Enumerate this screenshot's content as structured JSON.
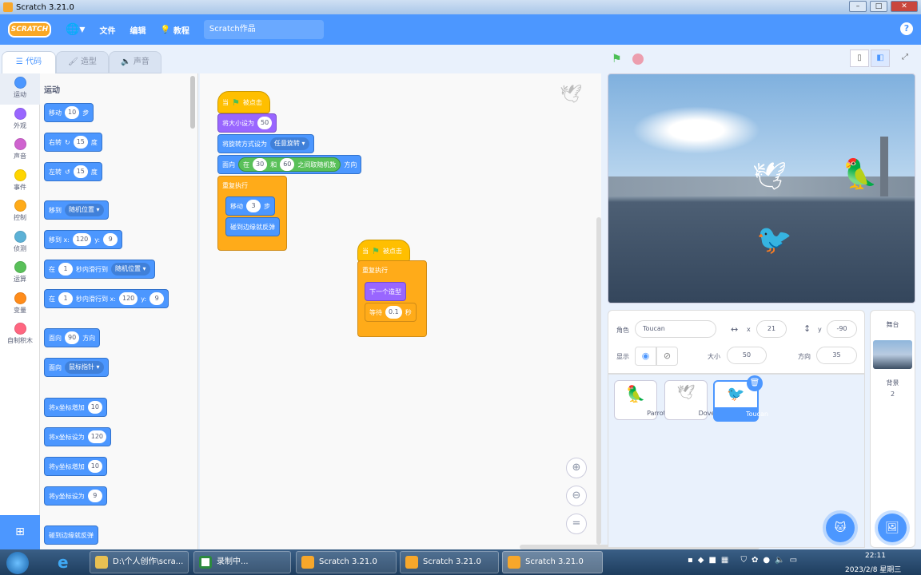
{
  "window": {
    "title": "Scratch 3.21.0"
  },
  "menu": {
    "logo": "SCRATCH",
    "file": "文件",
    "edit": "编辑",
    "tutorials": "教程",
    "project_title": "Scratch作品",
    "help": "?"
  },
  "tabs": [
    {
      "label": "代码"
    },
    {
      "label": "造型"
    },
    {
      "label": "声音"
    }
  ],
  "categories": [
    {
      "label": "运动",
      "color": "#4c97ff"
    },
    {
      "label": "外观",
      "color": "#9966ff"
    },
    {
      "label": "声音",
      "color": "#cf63cf"
    },
    {
      "label": "事件",
      "color": "#ffd500"
    },
    {
      "label": "控制",
      "color": "#ffab19"
    },
    {
      "label": "侦测",
      "color": "#5cb1d6"
    },
    {
      "label": "运算",
      "color": "#59c059"
    },
    {
      "label": "变量",
      "color": "#ff8c1a"
    },
    {
      "label": "自制积木",
      "color": "#ff6680"
    }
  ],
  "palette": {
    "heading": "运动",
    "move": {
      "a": "移动",
      "v": "10",
      "b": "步"
    },
    "turn_right": {
      "a": "右转",
      "v": "15",
      "b": "度"
    },
    "turn_left": {
      "a": "左转",
      "v": "15",
      "b": "度"
    },
    "goto": {
      "a": "移到",
      "dd": "随机位置"
    },
    "goto_xy": {
      "a": "移到 x:",
      "x": "120",
      "y_label": "y:",
      "y": "9"
    },
    "glide": {
      "a": "在",
      "v": "1",
      "b": "秒内滑行到",
      "dd": "随机位置"
    },
    "glide_xy": {
      "a": "在",
      "v": "1",
      "b": "秒内滑行到 x:",
      "x": "120",
      "y_label": "y:",
      "y": "9"
    },
    "point_dir": {
      "a": "面向",
      "v": "90",
      "b": "方向"
    },
    "point_towards": {
      "a": "面向",
      "dd": "鼠标指针"
    },
    "change_x": {
      "a": "将x坐标增加",
      "v": "10"
    },
    "set_x": {
      "a": "将x坐标设为",
      "v": "120"
    },
    "change_y": {
      "a": "将y坐标增加",
      "v": "10"
    },
    "set_y": {
      "a": "将y坐标设为",
      "v": "9"
    },
    "bounce": {
      "a": "碰到边缘就反弹"
    }
  },
  "script1": {
    "hat_a": "当",
    "hat_b": "被点击",
    "size_a": "将大小设为",
    "size_v": "50",
    "rot_a": "将旋转方式设为",
    "rot_dd": "任意旋转",
    "face_a": "面向",
    "rand_a": "在",
    "rand_v1": "30",
    "rand_b": "和",
    "rand_v2": "60",
    "rand_c": "之间取随机数",
    "face_b": "方向",
    "forever": "重复执行",
    "move_a": "移动",
    "move_v": "3",
    "move_b": "步",
    "bounce": "碰到边缘就反弹"
  },
  "script2": {
    "hat_a": "当",
    "hat_b": "被点击",
    "forever": "重复执行",
    "next": "下一个造型",
    "wait_a": "等待",
    "wait_v": "0.1",
    "wait_b": "秒"
  },
  "stage_controls": {
    "stop_tooltip": "停止"
  },
  "sprite_info": {
    "sprite_label": "角色",
    "sprite_name": "Toucan",
    "x_label": "x",
    "x": "21",
    "y_label": "y",
    "y": "-90",
    "show_label": "显示",
    "size_label": "大小",
    "size": "50",
    "direction_label": "方向",
    "direction": "35"
  },
  "sprites": [
    {
      "name": "Parrot"
    },
    {
      "name": "Dove"
    },
    {
      "name": "Toucan",
      "selected": true
    }
  ],
  "stage_pane": {
    "title": "舞台",
    "backdrops_label": "背景",
    "backdrops_count": "2"
  },
  "taskbar": {
    "items": [
      "D:\\个人创作\\scra...",
      "录制中...",
      "Scratch 3.21.0",
      "Scratch 3.21.0",
      "Scratch 3.21.0"
    ],
    "time": "22:11",
    "date": "2023/2/8 星期三"
  }
}
